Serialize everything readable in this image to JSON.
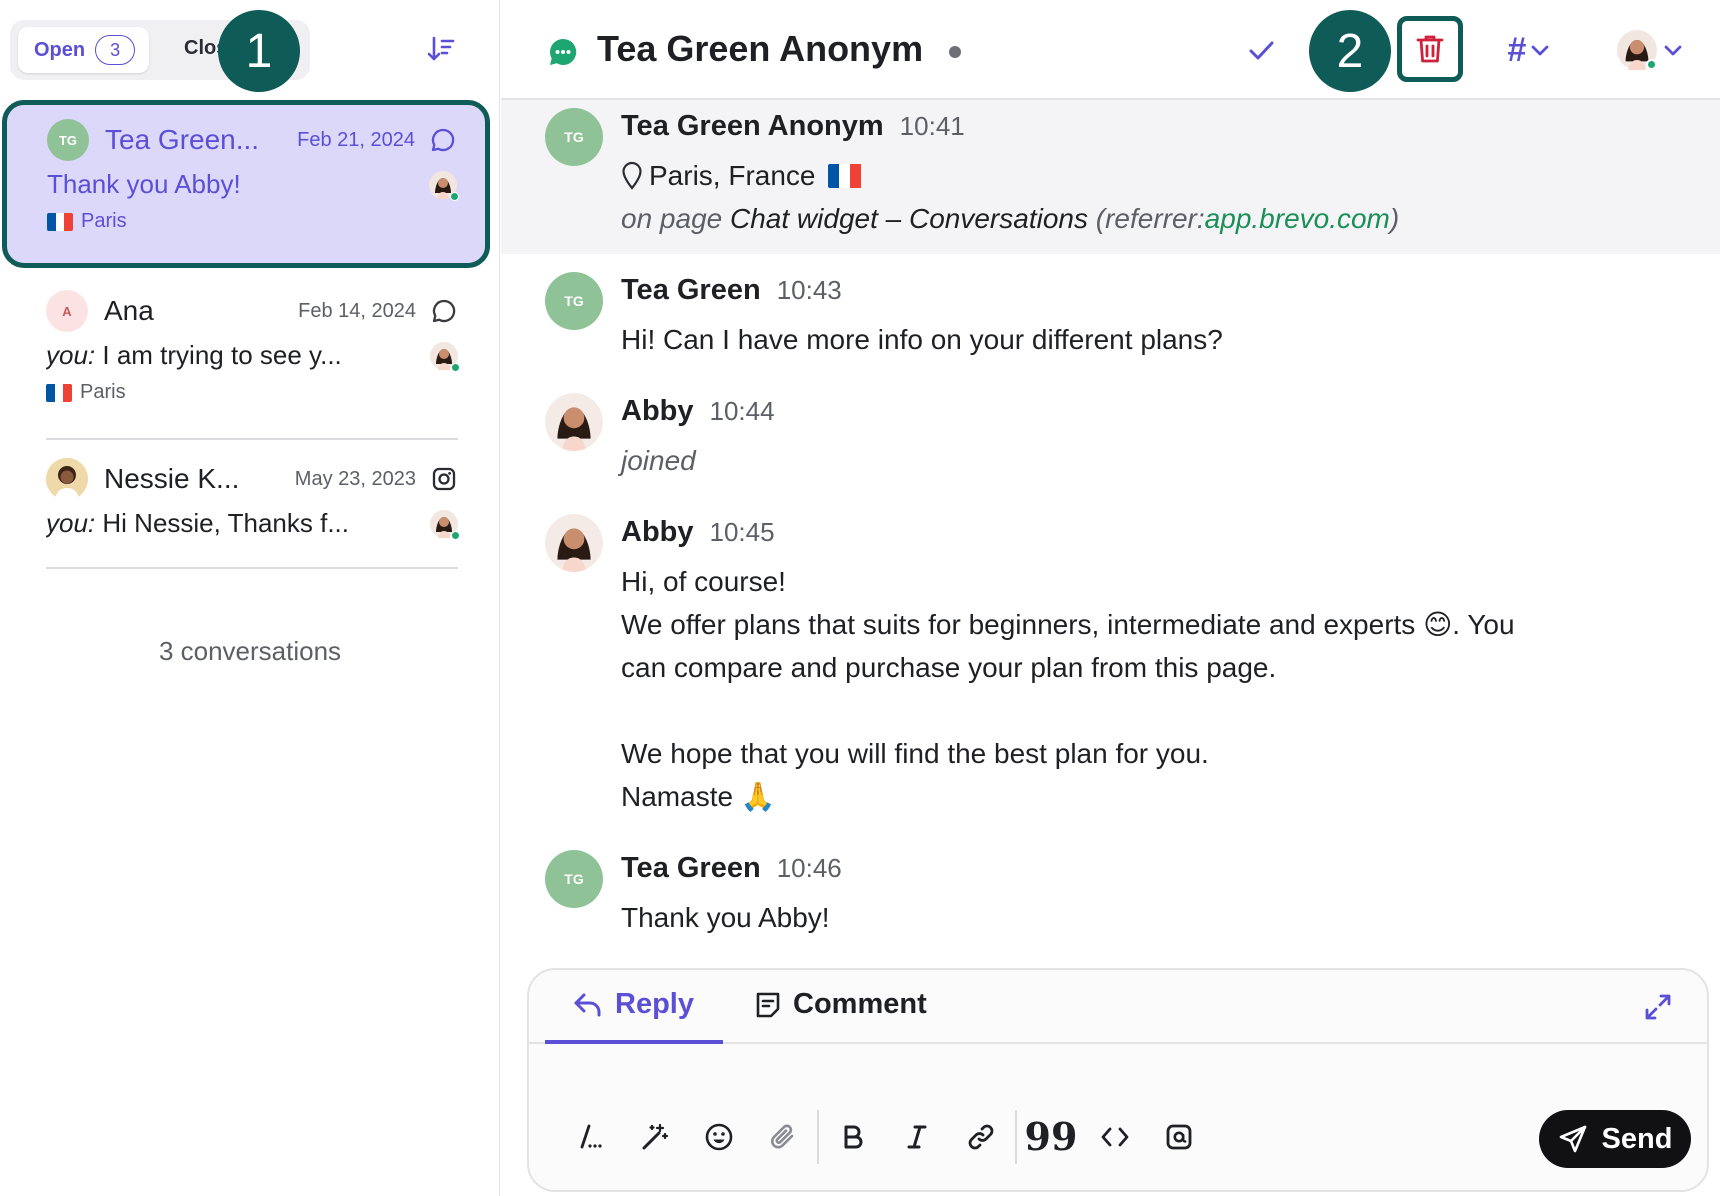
{
  "sidebar": {
    "open_tab": {
      "label": "Open",
      "count": "3"
    },
    "closed_tab": {
      "label": "Clos"
    },
    "callout_1": "1",
    "conversations": [
      {
        "initials": "TG",
        "name": "Tea Green...",
        "date": "Feb 21, 2024",
        "preview": "Thank you Abby!",
        "preview_prefix": "",
        "location": "Paris",
        "channel": "chat-icon",
        "avatar_color": "#8fc397"
      },
      {
        "initials": "A",
        "name": "Ana",
        "date": "Feb 14, 2024",
        "preview_prefix": "you:",
        "preview": "I am trying to see y...",
        "location": "Paris",
        "channel": "chat-icon",
        "avatar_color": "#f9dede"
      },
      {
        "initials": "",
        "name": "Nessie K...",
        "date": "May 23, 2023",
        "preview_prefix": "you:",
        "preview": "Hi Nessie, Thanks f...",
        "location": "",
        "channel": "instagram-icon"
      }
    ],
    "count_label": "3 conversations"
  },
  "header": {
    "title": "Tea Green Anonym",
    "callout_2": "2"
  },
  "visitor": {
    "author": "Tea Green Anonym",
    "time": "10:41",
    "location": "Paris, France",
    "page_prefix": "on page",
    "page_name": "Chat widget – Conversations",
    "referrer_prefix": "(referrer:",
    "referrer": "app.brevo.com",
    "referrer_suffix": ")"
  },
  "messages": [
    {
      "author": "Tea Green",
      "time": "10:43",
      "lines": [
        "Hi! Can I have more info on your different plans?"
      ]
    },
    {
      "author": "Abby",
      "time": "10:44",
      "lines": [
        "joined"
      ]
    },
    {
      "author": "Abby",
      "time": "10:45",
      "lines": [
        "Hi, of course!",
        "We offer plans that suits for beginners, intermediate and experts 😊. You",
        "can compare and purchase your plan from this page.",
        "",
        "We hope that you will find the best plan for you.",
        "Namaste 🙏"
      ]
    },
    {
      "author": "Tea Green",
      "time": "10:46",
      "lines": [
        "Thank you Abby!"
      ]
    }
  ],
  "composer": {
    "reply_label": "Reply",
    "comment_label": "Comment",
    "send_label": "Send"
  },
  "colors": {
    "accent": "#5b4fd6",
    "callout": "#0f5b57",
    "danger": "#d0213c",
    "online": "#1ea672",
    "link": "#1a8f57"
  }
}
